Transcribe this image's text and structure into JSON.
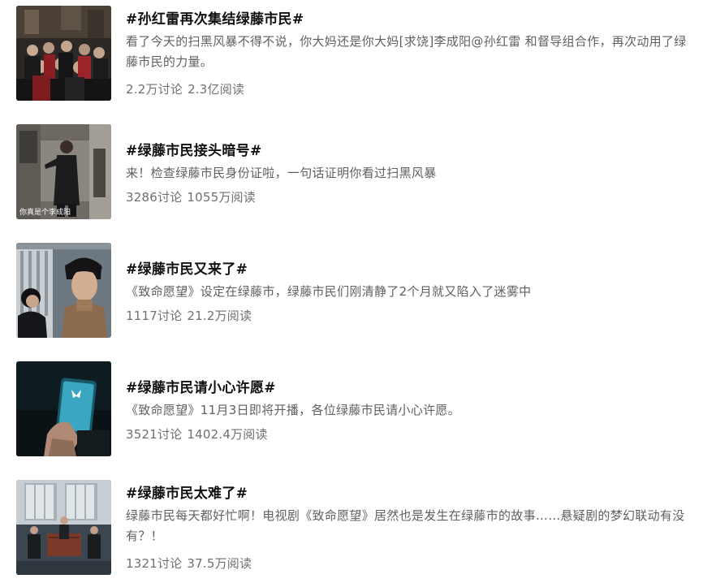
{
  "topics": [
    {
      "title": "#孙红雷再次集结绿藤市民#",
      "desc": "看了今天的扫黑风暴不得不说，你大妈还是你大妈[求饶]李成阳@孙红雷 和督导组合作，再次动用了绿藤市民的力量。",
      "discussions": "2.2万讨论",
      "reads": "2.3亿阅读",
      "thumb_icon": "crowd-scene-thumbnail"
    },
    {
      "title": "#绿藤市民接头暗号#",
      "desc": "来！检查绿藤市民身份证啦，一句话证明你看过扫黑风暴",
      "discussions": "3286讨论",
      "reads": "1055万阅读",
      "thumb_caption": "你真是个李成阳",
      "thumb_icon": "man-in-hallway-thumbnail"
    },
    {
      "title": "#绿藤市民又来了#",
      "desc": "《致命愿望》设定在绿藤市，绿藤市民们刚清静了2个月就又陷入了迷雾中",
      "discussions": "1117讨论",
      "reads": "21.2万阅读",
      "thumb_icon": "two-actors-thumbnail"
    },
    {
      "title": "#绿藤市民请小心许愿#",
      "desc": "《致命愿望》11月3日即将开播，各位绿藤市民请小心许愿。",
      "discussions": "3521讨论",
      "reads": "1402.4万阅读",
      "thumb_icon": "glowing-phone-thumbnail"
    },
    {
      "title": "#绿藤市民太难了#",
      "desc": "绿藤市民每天都好忙啊！电视剧《致命愿望》居然也是发生在绿藤市的故事……悬疑剧的梦幻联动有没有？！",
      "discussions": "1321讨论",
      "reads": "37.5万阅读",
      "thumb_icon": "office-room-thumbnail"
    }
  ]
}
